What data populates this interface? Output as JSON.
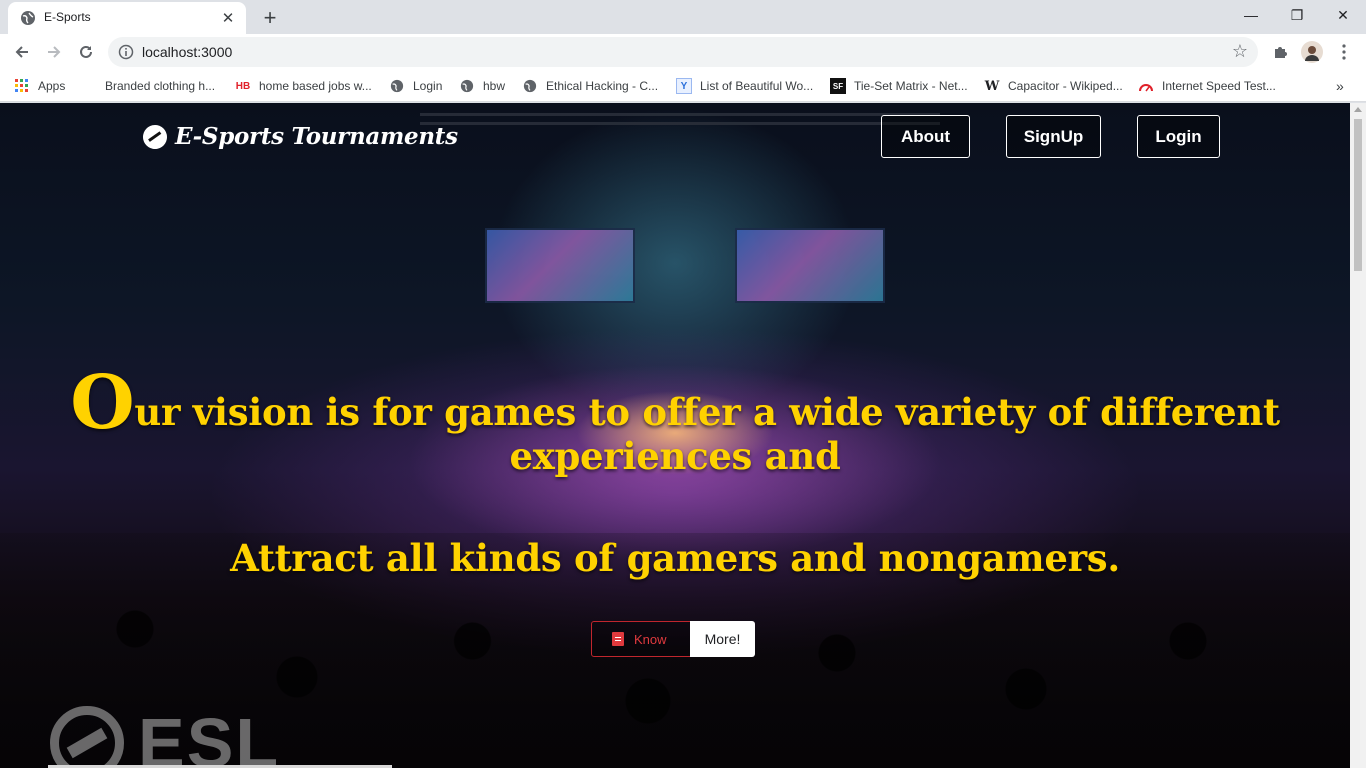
{
  "browser": {
    "tab_title": "E-Sports",
    "url": "localhost:3000",
    "bookmarks": [
      {
        "label": "Apps",
        "icon": "apps-grid-icon"
      },
      {
        "label": "Branded clothing h...",
        "icon": "blank-icon"
      },
      {
        "label": "home based jobs w...",
        "icon": "hb-icon"
      },
      {
        "label": "Login",
        "icon": "globe-icon"
      },
      {
        "label": "hbw",
        "icon": "globe-icon"
      },
      {
        "label": "Ethical Hacking - C...",
        "icon": "globe-icon"
      },
      {
        "label": "List of Beautiful Wo...",
        "icon": "yd-icon"
      },
      {
        "label": "Tie-Set Matrix - Net...",
        "icon": "sf-icon"
      },
      {
        "label": "Capacitor - Wikiped...",
        "icon": "wikipedia-icon"
      },
      {
        "label": "Internet Speed Test...",
        "icon": "speedometer-icon"
      }
    ]
  },
  "site": {
    "brand": "E-Sports Tournaments",
    "nav": {
      "about": "About",
      "signup": "SignUp",
      "login": "Login"
    },
    "hero": {
      "dropcap": "O",
      "line1_rest": "ur vision is for games to offer a wide variety of different experiences and",
      "line2": "Attract all kinds of gamers and nongamers."
    },
    "cta": {
      "know": "Know",
      "more": "More!"
    },
    "partner_logo": "ESL"
  },
  "colors": {
    "headline": "#ffd200",
    "cta_red": "#e03a3e",
    "chrome_bg": "#dee1e6"
  }
}
